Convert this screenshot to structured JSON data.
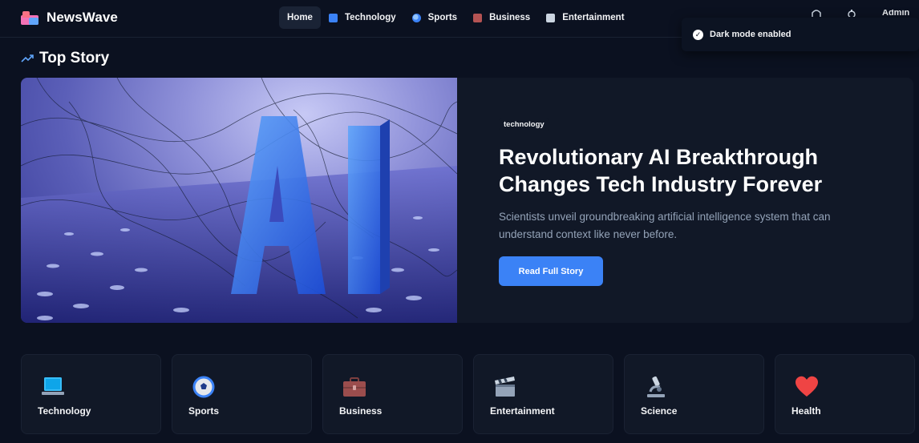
{
  "header": {
    "brand": "NewsWave",
    "nav": [
      {
        "label": "Home",
        "icon": "none",
        "active": true
      },
      {
        "label": "Technology",
        "icon": "laptop-icon",
        "active": false
      },
      {
        "label": "Sports",
        "icon": "ball-icon",
        "active": false
      },
      {
        "label": "Business",
        "icon": "briefcase-icon",
        "active": false
      },
      {
        "label": "Entertainment",
        "icon": "clapperboard-icon",
        "active": false
      }
    ],
    "admin_label": "Admin"
  },
  "toast": {
    "text": "Dark mode enabled",
    "icon": "check-circle-icon"
  },
  "section": {
    "title": "Top Story",
    "icon": "trending-up-icon"
  },
  "hero": {
    "tag": "technology",
    "title": "Revolutionary AI Breakthrough Changes Tech Industry Forever",
    "description": "Scientists unveil groundbreaking artificial intelligence system that can understand context like never before.",
    "button": "Read Full Story",
    "image_text": "AI"
  },
  "categories": [
    {
      "label": "Technology",
      "icon": "laptop-icon"
    },
    {
      "label": "Sports",
      "icon": "soccer-ball-icon"
    },
    {
      "label": "Business",
      "icon": "briefcase-icon"
    },
    {
      "label": "Entertainment",
      "icon": "clapperboard-icon"
    },
    {
      "label": "Science",
      "icon": "microscope-icon"
    },
    {
      "label": "Health",
      "icon": "heart-icon"
    }
  ],
  "colors": {
    "background": "#0b1120",
    "card": "#111827",
    "accent": "#3b82f6",
    "heart": "#ef4444"
  }
}
